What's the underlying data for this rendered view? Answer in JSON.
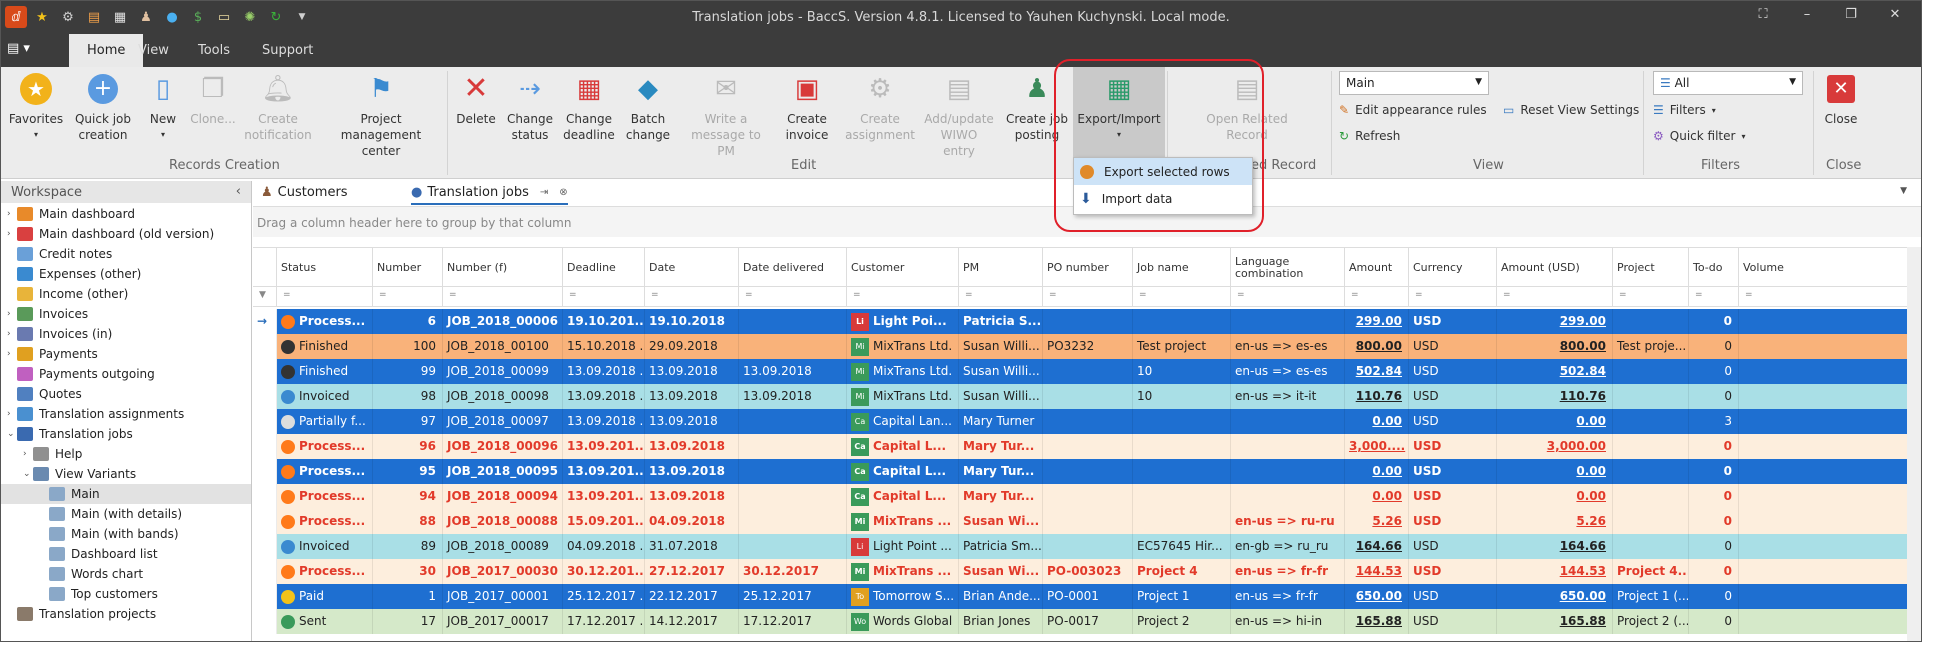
{
  "titlebar": {
    "title": "Translation jobs - BaccS. Version 4.8.1. Licensed to Yauhen Kuchynski. Local mode.",
    "qa_icons": [
      "app-icon",
      "star-icon",
      "gear-icon",
      "document-icon",
      "calendar-icon",
      "user-icon",
      "skype-icon",
      "dollar-icon",
      "note-icon",
      "sun-icon",
      "refresh-icon",
      "dropdown-icon"
    ]
  },
  "menu": {
    "home": "Home",
    "view": "View",
    "tools": "Tools",
    "support": "Support"
  },
  "ribbon": {
    "favorites": "Favorites",
    "quick_job": "Quick job",
    "quick_job2": "creation",
    "new": "New",
    "clone": "Clone...",
    "create_notif": "Create",
    "create_notif2": "notification",
    "pm_center": "Project",
    "pm_center2": "management center",
    "delete": "Delete",
    "change_status": "Change",
    "change_status2": "status",
    "change_deadline": "Change",
    "change_deadline2": "deadline",
    "batch": "Batch",
    "batch2": "change",
    "write_msg": "Write a",
    "write_msg2": "message to PM",
    "create_invoice": "Create",
    "create_invoice2": "invoice",
    "create_assign": "Create",
    "create_assign2": "assignment",
    "add_wiwo": "Add/update",
    "add_wiwo2": "WIWO entry",
    "create_posting": "Create job",
    "create_posting2": "posting",
    "export_import": "Export/Import",
    "open_related": "Open Related",
    "open_related2": "Record",
    "view_combo": "Main",
    "edit_rules": "Edit appearance rules",
    "reset_view": "Reset View Settings",
    "refresh": "Refresh",
    "filter_combo": "All",
    "filters": "Filters",
    "quick_filter": "Quick filter",
    "close": "Close",
    "groups": {
      "records": "Records Creation",
      "edit": "Edit",
      "related": "ed Record",
      "view": "View",
      "filters": "Filters",
      "close": "Close"
    }
  },
  "dropdown": {
    "export": "Export selected rows",
    "import": "Import data"
  },
  "workspace": {
    "title": "Workspace",
    "items": [
      {
        "label": "Main dashboard",
        "lvl": 0,
        "ex": "›",
        "color": "#e88a2a"
      },
      {
        "label": "Main dashboard (old version)",
        "lvl": 0,
        "ex": "›",
        "color": "#d94040"
      },
      {
        "label": "Credit notes",
        "lvl": 0,
        "ex": "",
        "color": "#6aa0d8"
      },
      {
        "label": "Expenses (other)",
        "lvl": 0,
        "ex": "",
        "color": "#3a8ad0"
      },
      {
        "label": "Income (other)",
        "lvl": 0,
        "ex": "",
        "color": "#e8b43a"
      },
      {
        "label": "Invoices",
        "lvl": 0,
        "ex": "›",
        "color": "#5a9a5a"
      },
      {
        "label": "Invoices (in)",
        "lvl": 0,
        "ex": "›",
        "color": "#6a7ab0"
      },
      {
        "label": "Payments",
        "lvl": 0,
        "ex": "›",
        "color": "#e0a020"
      },
      {
        "label": "Payments outgoing",
        "lvl": 0,
        "ex": "",
        "color": "#c060c0"
      },
      {
        "label": "Quotes",
        "lvl": 0,
        "ex": "",
        "color": "#5080c0"
      },
      {
        "label": "Translation assignments",
        "lvl": 0,
        "ex": "›",
        "color": "#4a90d0"
      },
      {
        "label": "Translation jobs",
        "lvl": 0,
        "ex": "⌄",
        "color": "#3a6ab0"
      },
      {
        "label": "Help",
        "lvl": 1,
        "ex": "›",
        "color": "#909090"
      },
      {
        "label": "View Variants",
        "lvl": 1,
        "ex": "⌄",
        "color": "#6a8ab0"
      },
      {
        "label": "Main",
        "lvl": 2,
        "ex": "",
        "color": "#8aa8c8"
      },
      {
        "label": "Main (with details)",
        "lvl": 2,
        "ex": "",
        "color": "#8aa8c8"
      },
      {
        "label": "Main (with bands)",
        "lvl": 2,
        "ex": "",
        "color": "#8aa8c8"
      },
      {
        "label": "Dashboard list",
        "lvl": 2,
        "ex": "",
        "color": "#8aa8c8"
      },
      {
        "label": "Words chart",
        "lvl": 2,
        "ex": "",
        "color": "#8aa8c8"
      },
      {
        "label": "Top customers",
        "lvl": 2,
        "ex": "",
        "color": "#8aa8c8"
      },
      {
        "label": "Translation projects",
        "lvl": 0,
        "ex": "",
        "color": "#8a7a6a"
      }
    ]
  },
  "tabs": {
    "customers": "Customers",
    "jobs": "Translation jobs"
  },
  "group_hint": "Drag a column header here to group by that column",
  "columns": [
    "Status",
    "Number",
    "Number (f)",
    "Deadline",
    "Date",
    "Date delivered",
    "Customer",
    "PM",
    "PO number",
    "Job name",
    "Language combination",
    "Amount",
    "Currency",
    "Amount (USD)",
    "Project",
    "To-do",
    "Volume"
  ],
  "rows": [
    {
      "status": "Process...",
      "num": "6",
      "numf": "JOB_2018_00006",
      "deadline": "19.10.201...",
      "date": "19.10.2018",
      "delivered": "",
      "cust_b": "Li",
      "cust": "Light Poi...",
      "pm": "Patricia S...",
      "po": "",
      "job": "",
      "lang": "",
      "amount": "299.00",
      "cur": "USD",
      "usd": "299.00",
      "proj": "",
      "todo": "0",
      "style": "blue",
      "bold": true,
      "ic": "#ff7a1a",
      "bc": "#d83a3a"
    },
    {
      "status": "Finished",
      "num": "100",
      "numf": "JOB_2018_00100",
      "deadline": "15.10.2018 ...",
      "date": "29.09.2018",
      "delivered": "",
      "cust_b": "Mi",
      "cust": "MixTrans Ltd.",
      "pm": "Susan Willi...",
      "po": "PO3232",
      "job": "Test project",
      "lang": "en-us => es-es",
      "amount": "800.00",
      "cur": "USD",
      "usd": "800.00",
      "proj": "Test proje...",
      "todo": "0",
      "style": "orange",
      "bold": false,
      "ic": "#333",
      "bc": "#3a9a5a"
    },
    {
      "status": "Finished",
      "num": "99",
      "numf": "JOB_2018_00099",
      "deadline": "13.09.2018 ...",
      "date": "13.09.2018",
      "delivered": "13.09.2018",
      "cust_b": "Mi",
      "cust": "MixTrans Ltd.",
      "pm": "Susan Willi...",
      "po": "",
      "job": "10",
      "lang": "en-us => es-es",
      "amount": "502.84",
      "cur": "USD",
      "usd": "502.84",
      "proj": "",
      "todo": "0",
      "style": "blue",
      "bold": false,
      "ic": "#333",
      "bc": "#3a9a5a"
    },
    {
      "status": "Invoiced",
      "num": "98",
      "numf": "JOB_2018_00098",
      "deadline": "13.09.2018 ...",
      "date": "13.09.2018",
      "delivered": "13.09.2018",
      "cust_b": "Mi",
      "cust": "MixTrans Ltd.",
      "pm": "Susan Willi...",
      "po": "",
      "job": "10",
      "lang": "en-us => it-it",
      "amount": "110.76",
      "cur": "USD",
      "usd": "110.76",
      "proj": "",
      "todo": "0",
      "style": "cyan",
      "bold": false,
      "ic": "#3a8ad0",
      "bc": "#3a9a5a"
    },
    {
      "status": "Partially f...",
      "num": "97",
      "numf": "JOB_2018_00097",
      "deadline": "13.09.2018 ...",
      "date": "13.09.2018",
      "delivered": "",
      "cust_b": "Ca",
      "cust": "Capital Lan...",
      "pm": "Mary Turner",
      "po": "",
      "job": "",
      "lang": "",
      "amount": "0.00",
      "cur": "USD",
      "usd": "0.00",
      "proj": "",
      "todo": "3",
      "style": "blue",
      "bold": false,
      "ic": "#ddd",
      "bc": "#3a9a5a"
    },
    {
      "status": "Process...",
      "num": "96",
      "numf": "JOB_2018_00096",
      "deadline": "13.09.201...",
      "date": "13.09.2018",
      "delivered": "",
      "cust_b": "Ca",
      "cust": "Capital L...",
      "pm": "Mary Tur...",
      "po": "",
      "job": "",
      "lang": "",
      "amount": "3,000....",
      "cur": "USD",
      "usd": "3,000.00",
      "proj": "",
      "todo": "0",
      "style": "cream",
      "bold": true,
      "ic": "#ff7a1a",
      "bc": "#3a9a5a"
    },
    {
      "status": "Process...",
      "num": "95",
      "numf": "JOB_2018_00095",
      "deadline": "13.09.201...",
      "date": "13.09.2018",
      "delivered": "",
      "cust_b": "Ca",
      "cust": "Capital L...",
      "pm": "Mary Tur...",
      "po": "",
      "job": "",
      "lang": "",
      "amount": "0.00",
      "cur": "USD",
      "usd": "0.00",
      "proj": "",
      "todo": "0",
      "style": "blue",
      "bold": true,
      "ic": "#ff7a1a",
      "bc": "#3a9a5a"
    },
    {
      "status": "Process...",
      "num": "94",
      "numf": "JOB_2018_00094",
      "deadline": "13.09.201...",
      "date": "13.09.2018",
      "delivered": "",
      "cust_b": "Ca",
      "cust": "Capital L...",
      "pm": "Mary Tur...",
      "po": "",
      "job": "",
      "lang": "",
      "amount": "0.00",
      "cur": "USD",
      "usd": "0.00",
      "proj": "",
      "todo": "0",
      "style": "cream",
      "bold": true,
      "ic": "#ff7a1a",
      "bc": "#3a9a5a"
    },
    {
      "status": "Process...",
      "num": "88",
      "numf": "JOB_2018_00088",
      "deadline": "15.09.201...",
      "date": "04.09.2018",
      "delivered": "",
      "cust_b": "Mi",
      "cust": "MixTrans ...",
      "pm": "Susan Wi...",
      "po": "",
      "job": "",
      "lang": "en-us => ru-ru",
      "amount": "5.26",
      "cur": "USD",
      "usd": "5.26",
      "proj": "",
      "todo": "0",
      "style": "cream",
      "bold": true,
      "ic": "#ff7a1a",
      "bc": "#3a9a5a"
    },
    {
      "status": "Invoiced",
      "num": "89",
      "numf": "JOB_2018_00089",
      "deadline": "04.09.2018 ...",
      "date": "31.07.2018",
      "delivered": "",
      "cust_b": "Li",
      "cust": "Light Point ...",
      "pm": "Patricia Sm...",
      "po": "",
      "job": "EC57645 Hir...",
      "lang": "en-gb => ru_ru",
      "amount": "164.66",
      "cur": "USD",
      "usd": "164.66",
      "proj": "",
      "todo": "0",
      "style": "cyan",
      "bold": false,
      "ic": "#3a8ad0",
      "bc": "#d83a3a"
    },
    {
      "status": "Process...",
      "num": "30",
      "numf": "JOB_2017_00030",
      "deadline": "30.12.201...",
      "date": "27.12.2017",
      "delivered": "30.12.2017",
      "cust_b": "Mi",
      "cust": "MixTrans ...",
      "pm": "Susan Wi...",
      "po": "PO-003023",
      "job": "Project 4",
      "lang": "en-us => fr-fr",
      "amount": "144.53",
      "cur": "USD",
      "usd": "144.53",
      "proj": "Project 4...",
      "todo": "0",
      "style": "cream",
      "bold": true,
      "ic": "#ff7a1a",
      "bc": "#3a9a5a"
    },
    {
      "status": "Paid",
      "num": "1",
      "numf": "JOB_2017_00001",
      "deadline": "25.12.2017 ...",
      "date": "22.12.2017",
      "delivered": "25.12.2017",
      "cust_b": "To",
      "cust": "Tomorrow S...",
      "pm": "Brian Ande...",
      "po": "PO-0001",
      "job": "Project 1",
      "lang": "en-us => fr-fr",
      "amount": "650.00",
      "cur": "USD",
      "usd": "650.00",
      "proj": "Project 1 (...",
      "todo": "0",
      "style": "blue",
      "bold": false,
      "ic": "#f2c21a",
      "bc": "#e0a020"
    },
    {
      "status": "Sent",
      "num": "17",
      "numf": "JOB_2017_00017",
      "deadline": "17.12.2017 ...",
      "date": "14.12.2017",
      "delivered": "17.12.2017",
      "cust_b": "Wo",
      "cust": "Words Global",
      "pm": "Brian Jones",
      "po": "PO-0017",
      "job": "Project 2",
      "lang": "en-us => hi-in",
      "amount": "165.88",
      "cur": "USD",
      "usd": "165.88",
      "proj": "Project 2 (...",
      "todo": "0",
      "style": "green",
      "bold": false,
      "ic": "#3a9a5a",
      "bc": "#3a9a5a"
    }
  ],
  "colors": {
    "blue": "#1e6fd1",
    "orange": "#f9b27a",
    "cyan": "#a9dfe6",
    "cream": "#fdeedd",
    "green": "#d5e9c9",
    "red_text": "#e23a2a"
  }
}
